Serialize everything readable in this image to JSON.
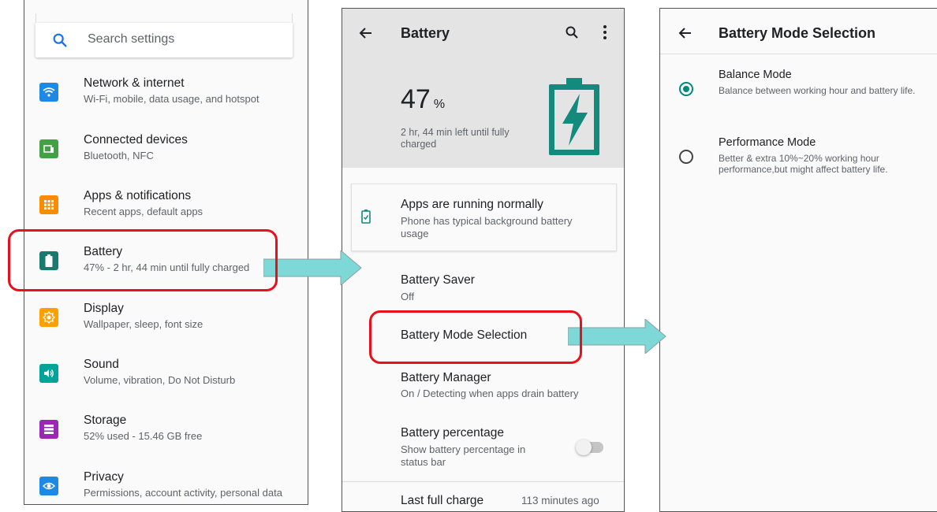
{
  "settings_panel": {
    "search_placeholder": "Search settings",
    "items": [
      {
        "title": "Network & internet",
        "subtitle": "Wi-Fi, mobile, data usage, and hotspot",
        "icon": "wifi-icon",
        "color": "#1e88e5"
      },
      {
        "title": "Connected devices",
        "subtitle": "Bluetooth, NFC",
        "icon": "connected-devices-icon",
        "color": "#43a047"
      },
      {
        "title": "Apps & notifications",
        "subtitle": "Recent apps, default apps",
        "icon": "apps-grid-icon",
        "color": "#fb8c00"
      },
      {
        "title": "Battery",
        "subtitle": "47% - 2 hr, 44 min until fully charged",
        "icon": "battery-icon",
        "color": "#1b7a6e"
      },
      {
        "title": "Display",
        "subtitle": "Wallpaper, sleep, font size",
        "icon": "brightness-icon",
        "color": "#ffa000"
      },
      {
        "title": "Sound",
        "subtitle": "Volume, vibration, Do Not Disturb",
        "icon": "volume-icon",
        "color": "#00a39a"
      },
      {
        "title": "Storage",
        "subtitle": "52% used - 15.46 GB free",
        "icon": "storage-icon",
        "color": "#9c27b0"
      },
      {
        "title": "Privacy",
        "subtitle": "Permissions, account activity, personal data",
        "icon": "privacy-eye-icon",
        "color": "#1e88e5"
      }
    ]
  },
  "battery_panel": {
    "title": "Battery",
    "percent": "47",
    "percent_unit": "%",
    "time_left": "2 hr, 44 min left until fully charged",
    "card_title": "Apps are running normally",
    "card_subtitle": "Phone has typical background battery usage",
    "saver_title": "Battery Saver",
    "saver_value": "Off",
    "mode_selection": "Battery Mode Selection",
    "manager_title": "Battery Manager",
    "manager_subtitle": "On / Detecting when apps drain battery",
    "percentage_title": "Battery percentage",
    "percentage_subtitle": "Show battery percentage in status bar",
    "last_charge_label": "Last full charge",
    "last_charge_value": "113 minutes ago",
    "accent": "#138a7d"
  },
  "mode_panel": {
    "title": "Battery Mode Selection",
    "options": [
      {
        "title": "Balance Mode",
        "desc": "Balance between working hour and battery life.",
        "selected": true
      },
      {
        "title": "Performance Mode",
        "desc": "Better & extra 10%~20% working hour performance,but might affect battery life.",
        "selected": false
      }
    ],
    "accent": "#00897b"
  },
  "annotation": {
    "highlight_color": "#e8101a",
    "arrow_color": "#7fd8d8"
  }
}
